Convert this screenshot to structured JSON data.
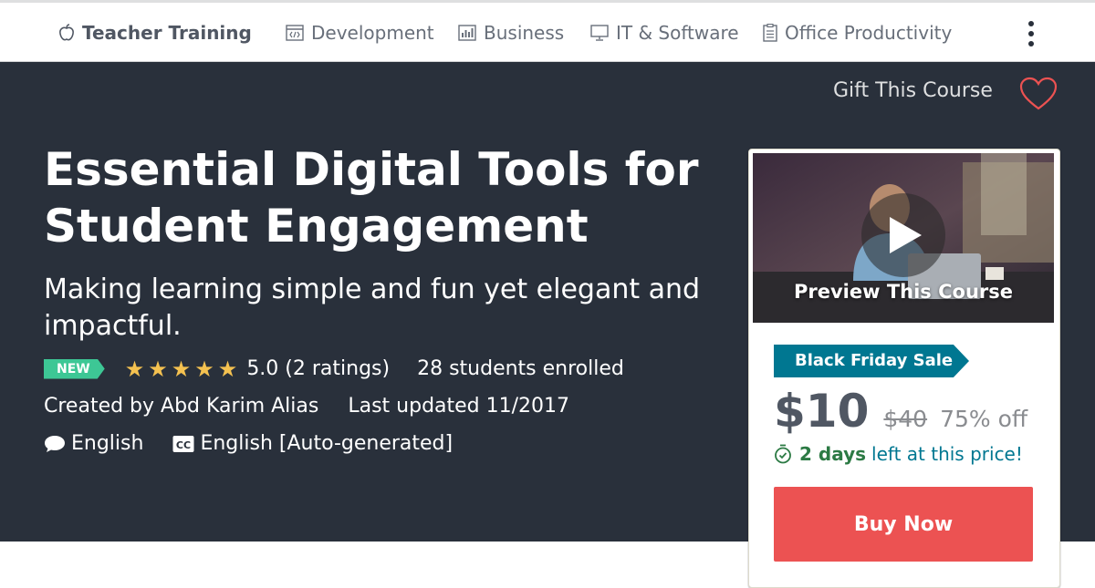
{
  "nav": {
    "items": [
      {
        "label": "Teacher Training",
        "icon": "apple-icon",
        "active": true
      },
      {
        "label": "Development",
        "icon": "code-window-icon"
      },
      {
        "label": "Business",
        "icon": "bar-chart-icon"
      },
      {
        "label": "IT & Software",
        "icon": "monitor-icon"
      },
      {
        "label": "Office Productivity",
        "icon": "clipboard-icon"
      }
    ],
    "more_icon": "vertical-dots-icon"
  },
  "hero": {
    "gift_label": "Gift This Course",
    "wishlist_icon": "heart-icon",
    "title": "Essential Digital Tools for Student Engagement",
    "subtitle": "Making learning simple and fun yet elegant and impactful.",
    "badge": "NEW",
    "rating": {
      "value": 5.0,
      "max": 5,
      "text": "5.0 (2 ratings)"
    },
    "enrolled": "28 students enrolled",
    "created_by": "Created by Abd Karim Alias",
    "last_updated": "Last updated 11/2017",
    "language": "English",
    "captions": "English [Auto-generated]"
  },
  "card": {
    "preview_label": "Preview This Course",
    "sale_badge": "Black Friday Sale",
    "price": "$10",
    "original_price": "$40",
    "discount": "75% off",
    "time_left_bold": "2 days",
    "time_left_rest": "left at this price!",
    "buy_button": "Buy Now"
  },
  "colors": {
    "hero_bg": "#29303b",
    "accent_teal": "#007791",
    "buy_red": "#ec5252",
    "star_gold": "#f4c150",
    "new_green": "#3dc795",
    "time_green": "#2c7a44"
  }
}
